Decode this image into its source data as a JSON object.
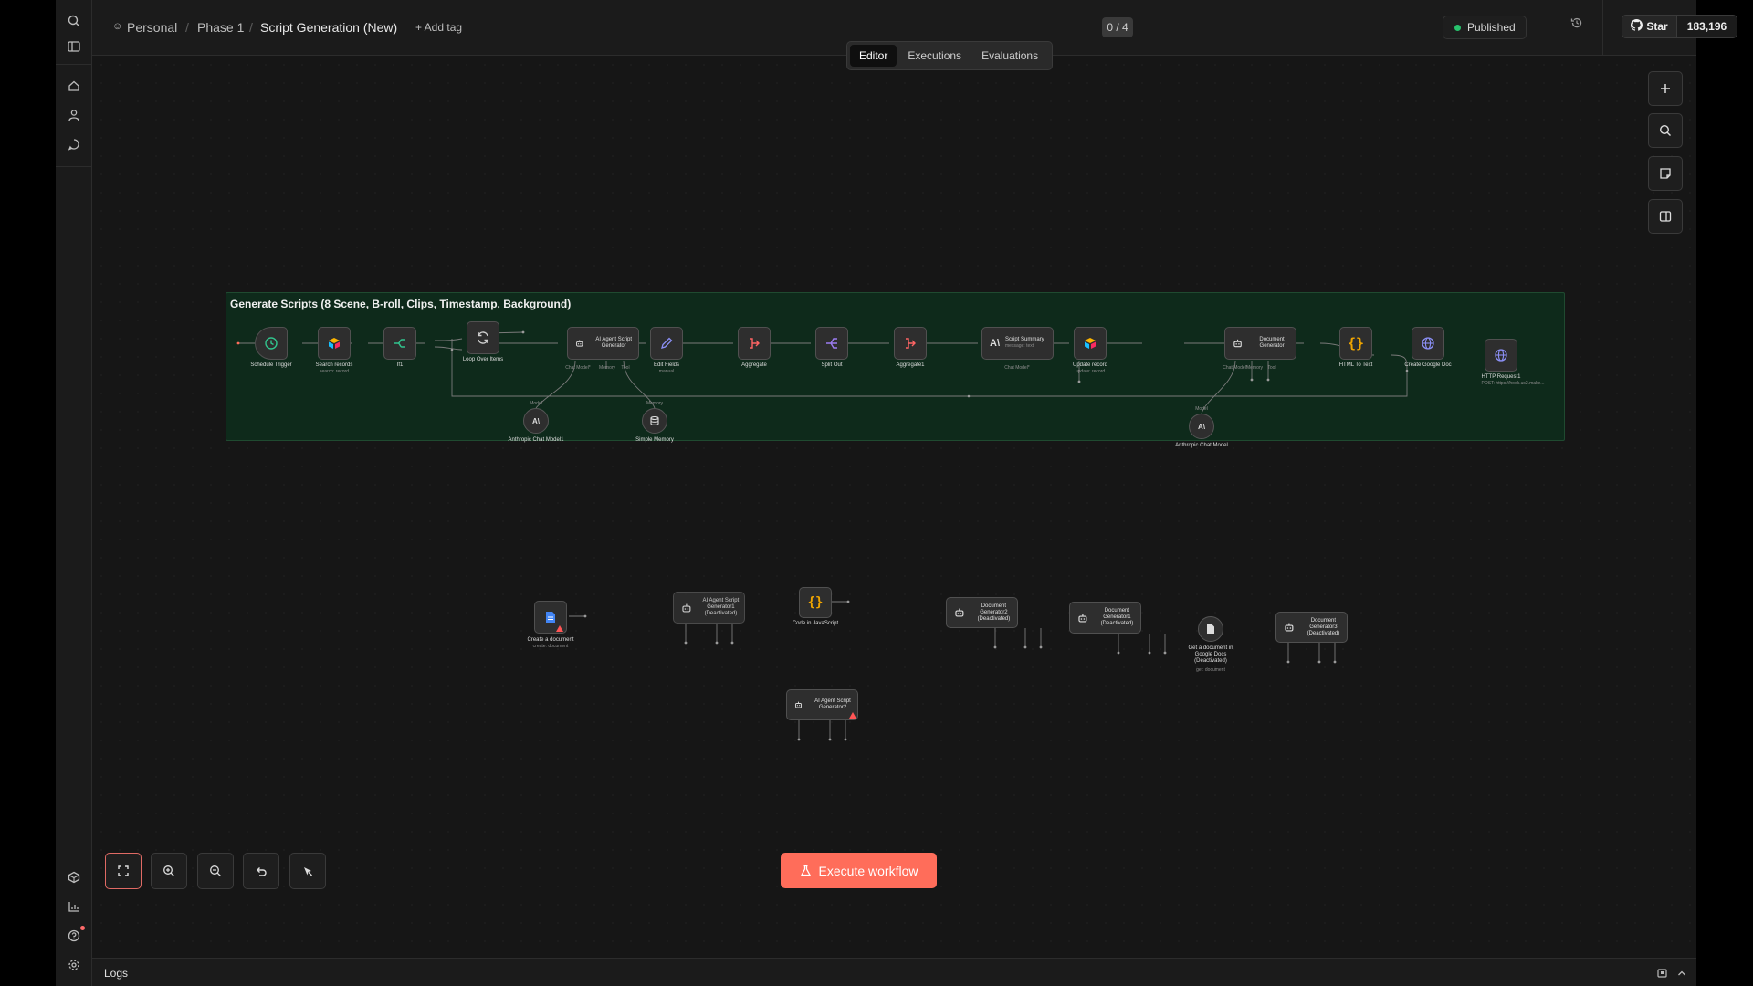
{
  "breadcrumb": {
    "owner": "Personal",
    "project": "Phase 1",
    "workflow": "Script Generation (New)",
    "add_tag": "+ Add tag"
  },
  "header": {
    "counter": "0 / 4",
    "status": "Published",
    "github_star": "Star",
    "github_count": "183,196"
  },
  "tabs": [
    "Editor",
    "Executions",
    "Evaluations"
  ],
  "active_tab": "Editor",
  "sticky_title": "Generate Scripts (8 Scene, B-roll, Clips, Timestamp, Background)",
  "main_nodes": [
    {
      "label": "Schedule Trigger",
      "icon": "clock-icon"
    },
    {
      "label": "Search records",
      "sub": "search: record",
      "icon": "airtable-icon"
    },
    {
      "label": "If1",
      "icon": "branch-icon"
    },
    {
      "label": "Loop Over Items",
      "icon": "loop-icon"
    },
    {
      "label": "AI Agent Script Generator",
      "icon": "robot-icon"
    },
    {
      "label": "Edit Fields",
      "sub": "manual",
      "icon": "pencil-icon"
    },
    {
      "label": "Aggregate",
      "icon": "aggregate-icon"
    },
    {
      "label": "Split Out",
      "icon": "split-icon"
    },
    {
      "label": "Aggregate1",
      "icon": "aggregate-icon"
    },
    {
      "label": "Script Summary",
      "sub": "message: text",
      "icon": "anthropic-icon"
    },
    {
      "label": "Update record",
      "sub": "update: record",
      "icon": "airtable-icon"
    },
    {
      "label": "Document Generator",
      "icon": "robot-icon"
    },
    {
      "label": "HTML To Text",
      "icon": "code-braces-icon"
    },
    {
      "label": "Create Google Doc",
      "icon": "globe-icon"
    },
    {
      "label": "HTTP Request1",
      "sub": "POST: https://hook.us2.make...",
      "icon": "globe-icon"
    }
  ],
  "sub_nodes": [
    {
      "label": "Anthropic Chat Model1",
      "tag": "Model"
    },
    {
      "label": "Simple Memory",
      "tag": "Memory"
    },
    {
      "label": "Anthropic Chat Model",
      "tag": "Model"
    }
  ],
  "port_labels": {
    "chat": "Chat Model*",
    "memory": "Memory",
    "tool": "Tool"
  },
  "loose_nodes": [
    {
      "label": "Create a document",
      "sub": "create: document"
    },
    {
      "label": "AI Agent Script Generator1 (Deactivated)"
    },
    {
      "label": "Code in JavaScript"
    },
    {
      "label": "Document Generator2 (Deactivated)"
    },
    {
      "label": "Document Generator1 (Deactivated)"
    },
    {
      "label": "Get a document in Google Docs (Deactivated)",
      "sub": "get: document"
    },
    {
      "label": "Document Generator3 (Deactivated)"
    },
    {
      "label": "AI Agent Script Generator2"
    }
  ],
  "execute_button": "Execute workflow",
  "logs_label": "Logs",
  "colors": {
    "accent": "#ff6d5a",
    "published": "#27c26c",
    "sticky_bg": "#0e2a1b"
  }
}
